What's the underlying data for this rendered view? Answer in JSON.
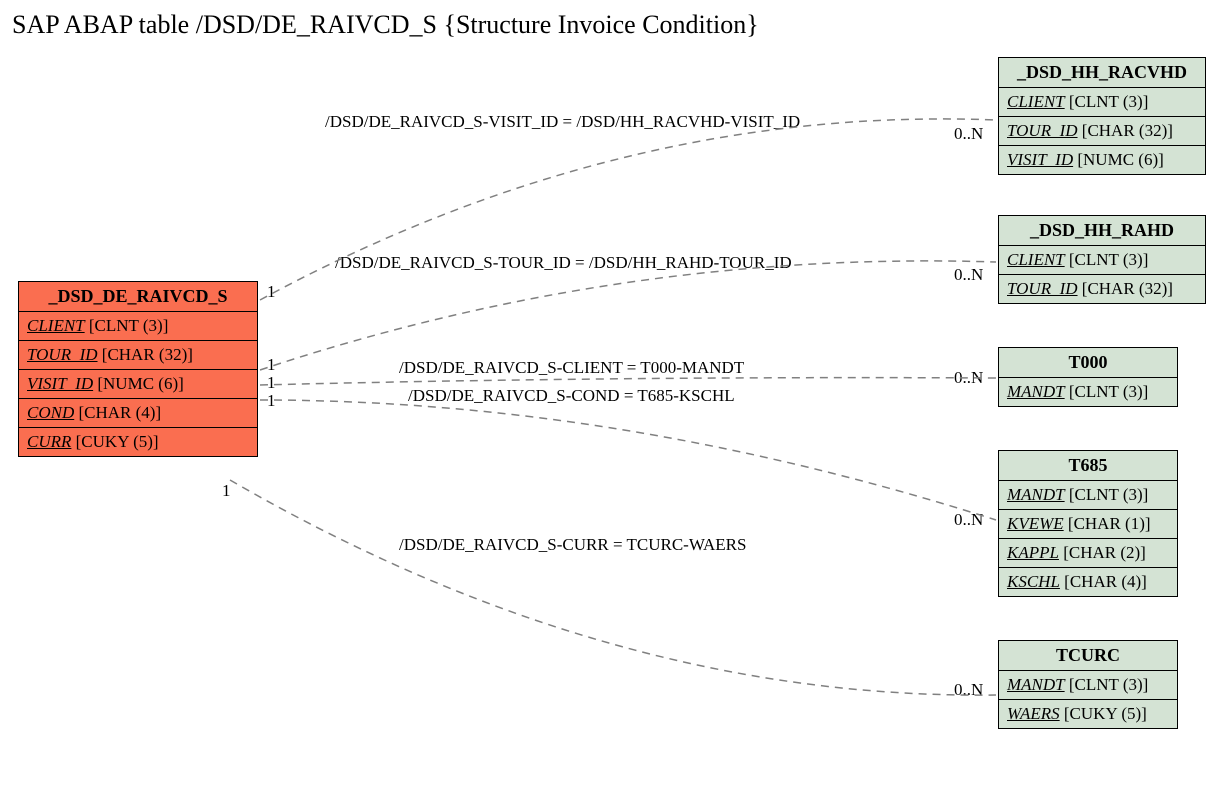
{
  "title": "SAP ABAP table /DSD/DE_RAIVCD_S {Structure Invoice Condition}",
  "main": {
    "name": "_DSD_DE_RAIVCD_S",
    "fields": [
      {
        "fname": "CLIENT",
        "type": "[CLNT (3)]"
      },
      {
        "fname": "TOUR_ID",
        "type": "[CHAR (32)]"
      },
      {
        "fname": "VISIT_ID",
        "type": "[NUMC (6)]"
      },
      {
        "fname": "COND",
        "type": "[CHAR (4)]"
      },
      {
        "fname": "CURR",
        "type": "[CUKY (5)]"
      }
    ]
  },
  "refs": [
    {
      "name": "_DSD_HH_RACVHD",
      "fields": [
        {
          "fname": "CLIENT",
          "type": "[CLNT (3)]"
        },
        {
          "fname": "TOUR_ID",
          "type": "[CHAR (32)]"
        },
        {
          "fname": "VISIT_ID",
          "type": "[NUMC (6)]"
        }
      ]
    },
    {
      "name": "_DSD_HH_RAHD",
      "fields": [
        {
          "fname": "CLIENT",
          "type": "[CLNT (3)]"
        },
        {
          "fname": "TOUR_ID",
          "type": "[CHAR (32)]"
        }
      ]
    },
    {
      "name": "T000",
      "fields": [
        {
          "fname": "MANDT",
          "type": "[CLNT (3)]"
        }
      ]
    },
    {
      "name": "T685",
      "fields": [
        {
          "fname": "MANDT",
          "type": "[CLNT (3)]"
        },
        {
          "fname": "KVEWE",
          "type": "[CHAR (1)]"
        },
        {
          "fname": "KAPPL",
          "type": "[CHAR (2)]"
        },
        {
          "fname": "KSCHL",
          "type": "[CHAR (4)]"
        }
      ]
    },
    {
      "name": "TCURC",
      "fields": [
        {
          "fname": "MANDT",
          "type": "[CLNT (3)]"
        },
        {
          "fname": "WAERS",
          "type": "[CUKY (5)]"
        }
      ]
    }
  ],
  "relations": [
    "/DSD/DE_RAIVCD_S-VISIT_ID = /DSD/HH_RACVHD-VISIT_ID",
    "/DSD/DE_RAIVCD_S-TOUR_ID = /DSD/HH_RAHD-TOUR_ID",
    "/DSD/DE_RAIVCD_S-CLIENT = T000-MANDT",
    "/DSD/DE_RAIVCD_S-COND = T685-KSCHL",
    "/DSD/DE_RAIVCD_S-CURR = TCURC-WAERS"
  ],
  "card_left": "1",
  "card_right": "0..N"
}
